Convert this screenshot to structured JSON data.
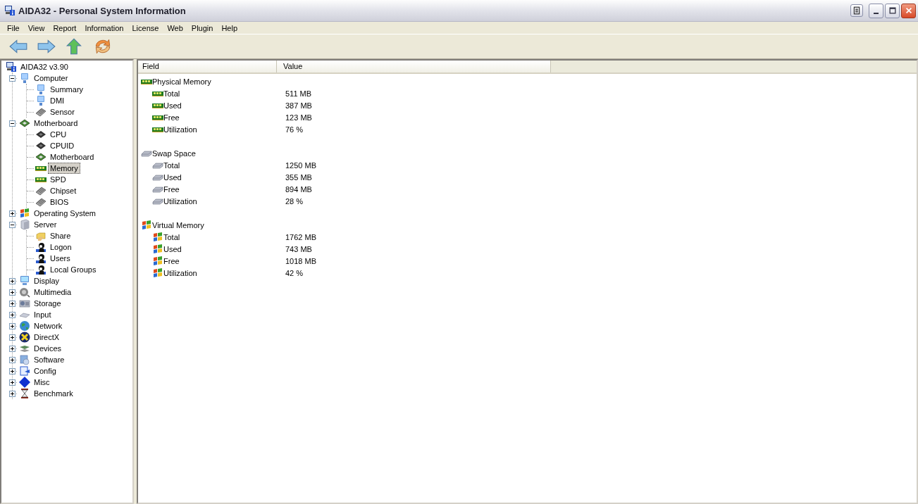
{
  "window": {
    "title": "AIDA32 - Personal System Information"
  },
  "menu": [
    "File",
    "View",
    "Report",
    "Information",
    "License",
    "Web",
    "Plugin",
    "Help"
  ],
  "toolbar": [
    {
      "kind": "back"
    },
    {
      "kind": "forward"
    },
    {
      "kind": "up"
    },
    {
      "kind": "refresh"
    }
  ],
  "tree": {
    "label": "AIDA32 v3.90",
    "kind": "app",
    "children": [
      {
        "label": "Computer",
        "kind": "computer",
        "expanded": true,
        "selected": false,
        "children": [
          {
            "label": "Summary",
            "kind": "computer",
            "selected": false
          },
          {
            "label": "DMI",
            "kind": "computer",
            "selected": false
          },
          {
            "label": "Sensor",
            "kind": "chip",
            "selected": false
          }
        ]
      },
      {
        "label": "Motherboard",
        "kind": "board",
        "expanded": true,
        "selected": false,
        "children": [
          {
            "label": "CPU",
            "kind": "cpu",
            "selected": false
          },
          {
            "label": "CPUID",
            "kind": "cpu",
            "selected": false
          },
          {
            "label": "Motherboard",
            "kind": "board",
            "selected": false
          },
          {
            "label": "Memory",
            "kind": "ram",
            "selected": true
          },
          {
            "label": "SPD",
            "kind": "ram",
            "selected": false
          },
          {
            "label": "Chipset",
            "kind": "chip",
            "selected": false
          },
          {
            "label": "BIOS",
            "kind": "chip",
            "selected": false
          }
        ]
      },
      {
        "label": "Operating System",
        "kind": "os",
        "expanded": false,
        "selected": false
      },
      {
        "label": "Server",
        "kind": "server",
        "expanded": true,
        "selected": false,
        "children": [
          {
            "label": "Share",
            "kind": "share",
            "selected": false
          },
          {
            "label": "Logon",
            "kind": "user",
            "selected": false
          },
          {
            "label": "Users",
            "kind": "user",
            "selected": false
          },
          {
            "label": "Local Groups",
            "kind": "user",
            "selected": false
          }
        ]
      },
      {
        "label": "Display",
        "kind": "display",
        "expanded": false,
        "selected": false
      },
      {
        "label": "Multimedia",
        "kind": "media",
        "expanded": false,
        "selected": false
      },
      {
        "label": "Storage",
        "kind": "storage",
        "expanded": false,
        "selected": false
      },
      {
        "label": "Input",
        "kind": "input",
        "expanded": false,
        "selected": false
      },
      {
        "label": "Network",
        "kind": "network",
        "expanded": false,
        "selected": false
      },
      {
        "label": "DirectX",
        "kind": "directx",
        "expanded": false,
        "selected": false
      },
      {
        "label": "Devices",
        "kind": "devices",
        "expanded": false,
        "selected": false
      },
      {
        "label": "Software",
        "kind": "software",
        "expanded": false,
        "selected": false
      },
      {
        "label": "Config",
        "kind": "config",
        "expanded": false,
        "selected": false
      },
      {
        "label": "Misc",
        "kind": "misc",
        "expanded": false,
        "selected": false
      },
      {
        "label": "Benchmark",
        "kind": "benchmark",
        "expanded": false,
        "selected": false
      }
    ]
  },
  "table": {
    "columns": [
      "Field",
      "Value"
    ],
    "groups": [
      {
        "title": "Physical Memory",
        "kind": "ram",
        "rows": [
          {
            "field": "Total",
            "value": "511 MB"
          },
          {
            "field": "Used",
            "value": "387 MB"
          },
          {
            "field": "Free",
            "value": "123 MB"
          },
          {
            "field": "Utilization",
            "value": "76 %"
          }
        ]
      },
      {
        "title": "Swap Space",
        "kind": "disk",
        "rows": [
          {
            "field": "Total",
            "value": "1250 MB"
          },
          {
            "field": "Used",
            "value": "355 MB"
          },
          {
            "field": "Free",
            "value": "894 MB"
          },
          {
            "field": "Utilization",
            "value": "28 %"
          }
        ]
      },
      {
        "title": "Virtual Memory",
        "kind": "os",
        "rows": [
          {
            "field": "Total",
            "value": "1762 MB"
          },
          {
            "field": "Used",
            "value": "743 MB"
          },
          {
            "field": "Free",
            "value": "1018 MB"
          },
          {
            "field": "Utilization",
            "value": "42 %"
          }
        ]
      }
    ]
  }
}
